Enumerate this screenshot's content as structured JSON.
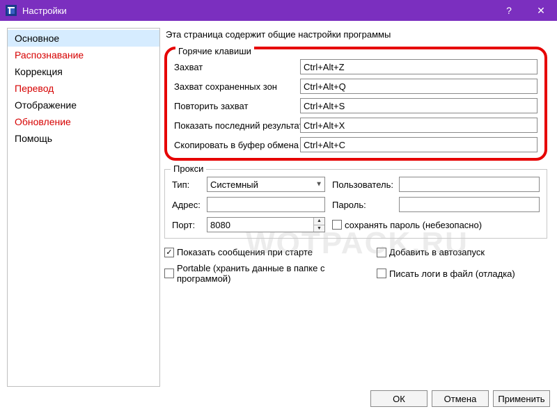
{
  "title": "Настройки",
  "titlebar": {
    "help": "?",
    "close": "✕"
  },
  "sidebar": {
    "items": [
      {
        "label": "Основное",
        "selected": true,
        "red": false
      },
      {
        "label": "Распознавание",
        "selected": false,
        "red": true
      },
      {
        "label": "Коррекция",
        "selected": false,
        "red": false
      },
      {
        "label": "Перевод",
        "selected": false,
        "red": true
      },
      {
        "label": "Отображение",
        "selected": false,
        "red": false
      },
      {
        "label": "Обновление",
        "selected": false,
        "red": true
      },
      {
        "label": "Помощь",
        "selected": false,
        "red": false
      }
    ]
  },
  "page_desc": "Эта страница содержит общие настройки программы",
  "hotkeys": {
    "legend": "Горячие клавиши",
    "rows": [
      {
        "label": "Захват",
        "value": "Ctrl+Alt+Z"
      },
      {
        "label": "Захват сохраненных зон",
        "value": "Ctrl+Alt+Q"
      },
      {
        "label": "Повторить захват",
        "value": "Ctrl+Alt+S"
      },
      {
        "label": "Показать последний результат",
        "value": "Ctrl+Alt+X"
      },
      {
        "label": "Скопировать в буфер обмена",
        "value": "Ctrl+Alt+C"
      }
    ]
  },
  "proxy": {
    "legend": "Прокси",
    "type_label": "Тип:",
    "type_value": "Системный",
    "addr_label": "Адрес:",
    "addr_value": "",
    "port_label": "Порт:",
    "port_value": "8080",
    "user_label": "Пользователь:",
    "user_value": "",
    "pass_label": "Пароль:",
    "pass_value": "",
    "save_pass_label": "сохранять пароль (небезопасно)",
    "save_pass_checked": false
  },
  "options": {
    "show_startup_msgs": {
      "label": "Показать сообщения при старте",
      "checked": true
    },
    "autostart": {
      "label": "Добавить в автозапуск",
      "checked": false
    },
    "portable": {
      "label": "Portable (хранить данные в папке с программой)",
      "checked": false
    },
    "debug_logs": {
      "label": "Писать логи в файл (отладка)",
      "checked": false
    }
  },
  "footer": {
    "ok": "ОК",
    "cancel": "Отмена",
    "apply": "Применить"
  },
  "watermark": "WOTPACK.RU"
}
